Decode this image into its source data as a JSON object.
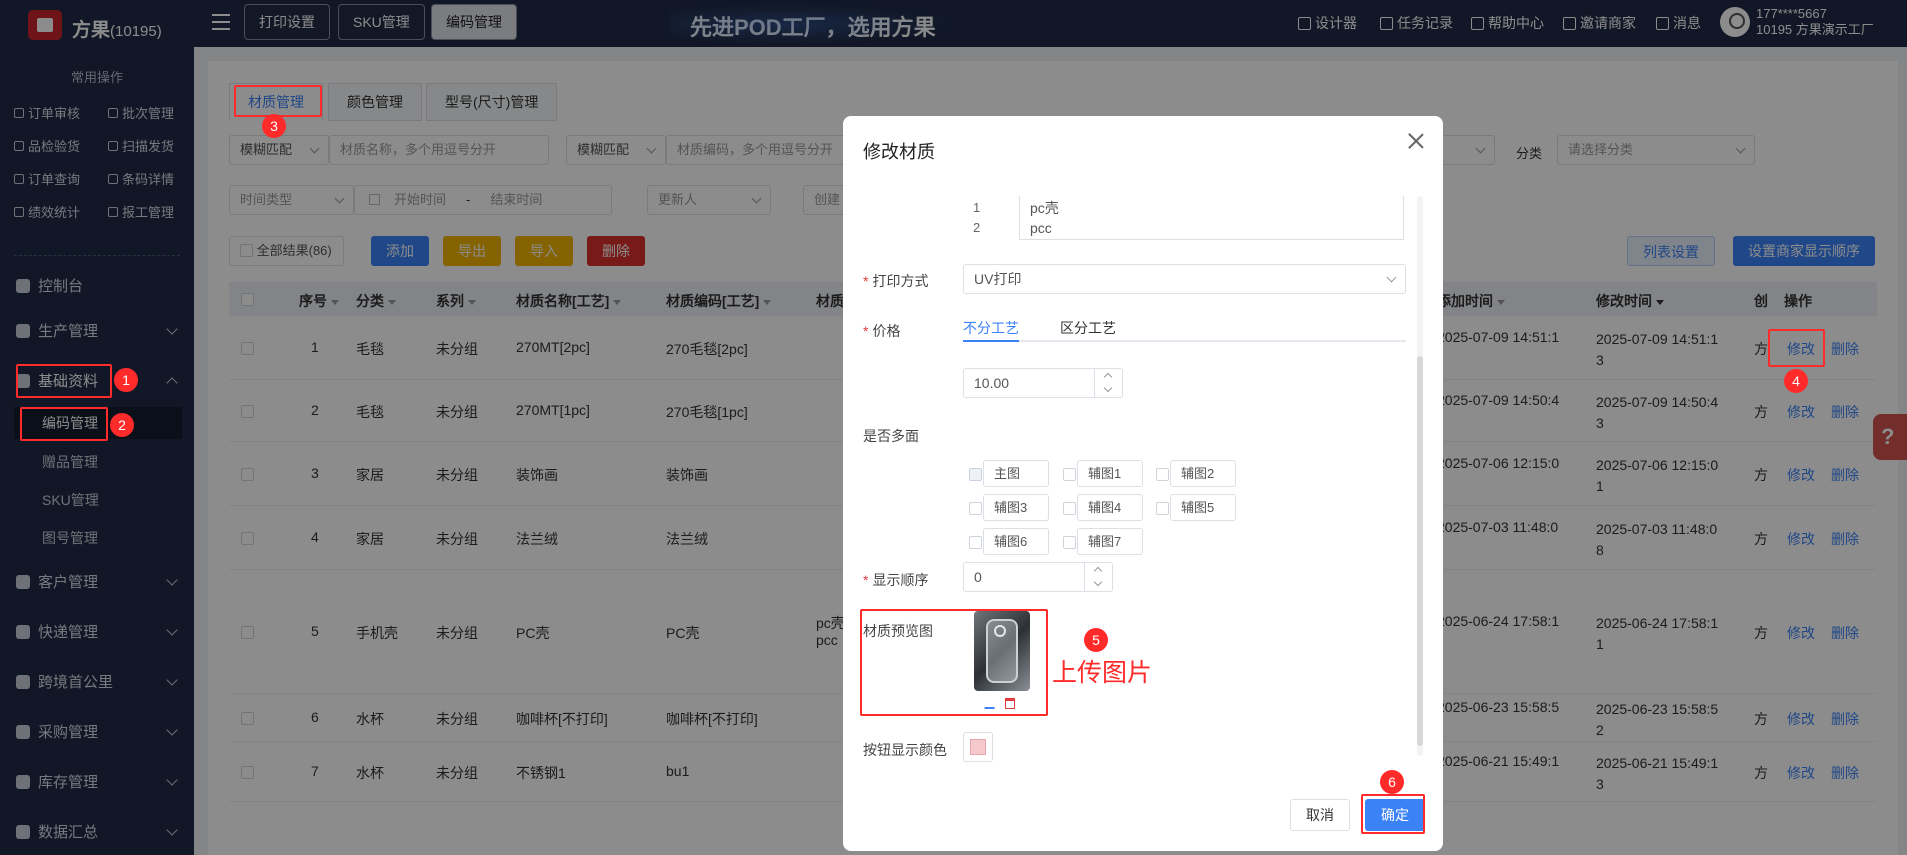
{
  "header": {
    "brand": "方果",
    "brand_id": "(10195)",
    "tabs": [
      "打印设置",
      "SKU管理",
      "编码管理"
    ],
    "slogan": "先进POD工厂，选用方果",
    "links": [
      "设计器",
      "任务记录",
      "帮助中心",
      "邀请商家",
      "消息"
    ],
    "user_phone": "177****5667",
    "user_name": "10195 方果演示工厂"
  },
  "sidebar": {
    "section_title": "常用操作",
    "quick": [
      "订单审核",
      "批次管理",
      "品检验货",
      "扫描发货",
      "订单查询",
      "条码详情",
      "绩效统计",
      "报工管理"
    ],
    "nav": [
      "控制台",
      "生产管理",
      "基础资料",
      "客户管理",
      "快递管理",
      "跨境首公里",
      "采购管理",
      "库存管理",
      "数据汇总"
    ],
    "sub": [
      "编码管理",
      "赠品管理",
      "SKU管理",
      "图号管理"
    ]
  },
  "content": {
    "tabs": [
      "材质管理",
      "颜色管理",
      "型号(尺寸)管理"
    ],
    "filter": {
      "match1": "模糊匹配",
      "name_ph": "材质名称，多个用逗号分开",
      "match2": "模糊匹配",
      "code_ph": "材质编码，多个用逗号分开",
      "category_label": "分类",
      "category_ph": "请选择分类",
      "time_type": "时间类型",
      "start_ph": "开始时间",
      "dash": "-",
      "end_ph": "结束时间",
      "updater": "更新人",
      "creator": "创建"
    },
    "toolbar": {
      "all_results": "全部结果(86)",
      "add": "添加",
      "export": "导出",
      "import": "导入",
      "delete": "删除",
      "column_settings": "列表设置",
      "merchant_order": "设置商家显示顺序"
    },
    "columns": [
      "序号",
      "分类",
      "系列",
      "材质名称[工艺]",
      "材质编码[工艺]",
      "材质",
      "添加时间",
      "修改时间",
      "创",
      "操作"
    ],
    "rows": [
      {
        "no": "1",
        "cat": "毛毯",
        "series": "未分组",
        "name": "270MT[2pc]",
        "code": "270毛毯[2pc]",
        "mat": "",
        "add": "2025-07-09 14:51:1",
        "mod1": "2025-07-09 14:51:1",
        "mod2": "3",
        "cr": "方"
      },
      {
        "no": "2",
        "cat": "毛毯",
        "series": "未分组",
        "name": "270MT[1pc]",
        "code": "270毛毯[1pc]",
        "mat": "",
        "add": "2025-07-09 14:50:4",
        "mod1": "2025-07-09 14:50:4",
        "mod2": "3",
        "cr": "方"
      },
      {
        "no": "3",
        "cat": "家居",
        "series": "未分组",
        "name": "装饰画",
        "code": "装饰画",
        "mat": "",
        "add": "2025-07-06 12:15:0",
        "mod1": "2025-07-06 12:15:0",
        "mod2": "1",
        "cr": "方"
      },
      {
        "no": "4",
        "cat": "家居",
        "series": "未分组",
        "name": "法兰绒",
        "code": "法兰绒",
        "mat": "",
        "add": "2025-07-03 11:48:0",
        "mod1": "2025-07-03 11:48:0",
        "mod2": "8",
        "cr": "方"
      },
      {
        "no": "5",
        "cat": "手机壳",
        "series": "未分组",
        "name": "PC壳",
        "code": "PC壳",
        "mat": "pc壳\npcc",
        "add": "2025-06-24 17:58:1",
        "mod1": "2025-06-24 17:58:1",
        "mod2": "1",
        "cr": "方"
      },
      {
        "no": "6",
        "cat": "水杯",
        "series": "未分组",
        "name": "咖啡杯[不打印]",
        "code": "咖啡杯[不打印]",
        "mat": "",
        "add": "2025-06-23 15:58:5",
        "mod1": "2025-06-23 15:58:5",
        "mod2": "2",
        "cr": "方"
      },
      {
        "no": "7",
        "cat": "水杯",
        "series": "未分组",
        "name": "不锈钢1",
        "code": "bu1",
        "mat": "",
        "add": "2025-06-21 15:49:1",
        "mod1": "2025-06-21 15:49:1",
        "mod2": "3",
        "cr": "方"
      }
    ],
    "edit": "修改",
    "del": "删除"
  },
  "dialog": {
    "title": "修改材质",
    "list_nums": [
      "1",
      "2"
    ],
    "list_items": [
      "pc壳",
      "pcc"
    ],
    "print_label": "打印方式",
    "print_value": "UV打印",
    "price_label": "价格",
    "price_tabs": [
      "不分工艺",
      "区分工艺"
    ],
    "price_value": "10.00",
    "multi_label": "是否多面",
    "faces": [
      "主图",
      "辅图1",
      "辅图2",
      "辅图3",
      "辅图4",
      "辅图5",
      "辅图6",
      "辅图7"
    ],
    "order_label": "显示顺序",
    "order_value": "0",
    "preview_label": "材质预览图",
    "color_label": "按钮显示颜色",
    "cancel": "取消",
    "confirm": "确定"
  },
  "annotations": {
    "badges": [
      "1",
      "2",
      "3",
      "4",
      "5",
      "6"
    ],
    "upload_note": "上传图片"
  },
  "help_icon": "?"
}
